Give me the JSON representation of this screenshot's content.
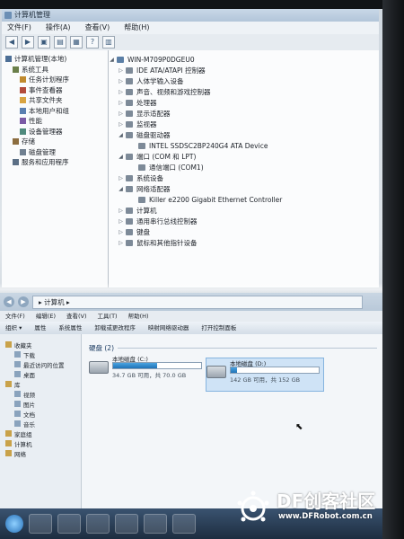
{
  "cm": {
    "title": "计算机管理",
    "menu": [
      "文件(F)",
      "操作(A)",
      "查看(V)",
      "帮助(H)"
    ],
    "tree": [
      {
        "label": "计算机管理(本地)",
        "level": 0,
        "icon": "computer-icon"
      },
      {
        "label": "系统工具",
        "level": 1,
        "icon": "tools-icon"
      },
      {
        "label": "任务计划程序",
        "level": 2,
        "icon": "clock-icon"
      },
      {
        "label": "事件查看器",
        "level": 2,
        "icon": "event-icon"
      },
      {
        "label": "共享文件夹",
        "level": 2,
        "icon": "folder-icon"
      },
      {
        "label": "本地用户和组",
        "level": 2,
        "icon": "users-icon"
      },
      {
        "label": "性能",
        "level": 2,
        "icon": "perf-icon"
      },
      {
        "label": "设备管理器",
        "level": 2,
        "icon": "device-icon"
      },
      {
        "label": "存储",
        "level": 1,
        "icon": "storage-icon"
      },
      {
        "label": "磁盘管理",
        "level": 2,
        "icon": "disk-icon"
      },
      {
        "label": "服务和应用程序",
        "level": 1,
        "icon": "services-icon"
      }
    ],
    "device_root": "WIN-M709P0DGEU0",
    "devices": [
      {
        "label": "IDE ATA/ATAPI 控制器",
        "level": 1,
        "expanded": false
      },
      {
        "label": "人体学输入设备",
        "level": 1,
        "expanded": false
      },
      {
        "label": "声音、视频和游戏控制器",
        "level": 1,
        "expanded": false
      },
      {
        "label": "处理器",
        "level": 1,
        "expanded": false
      },
      {
        "label": "显示适配器",
        "level": 1,
        "expanded": false
      },
      {
        "label": "监视器",
        "level": 1,
        "expanded": false
      },
      {
        "label": "磁盘驱动器",
        "level": 1,
        "expanded": true
      },
      {
        "label": "INTEL SSDSC2BP240G4 ATA Device",
        "level": 2,
        "expanded": null
      },
      {
        "label": "端口 (COM 和 LPT)",
        "level": 1,
        "expanded": true
      },
      {
        "label": "通信端口 (COM1)",
        "level": 2,
        "expanded": null
      },
      {
        "label": "系统设备",
        "level": 1,
        "expanded": false
      },
      {
        "label": "网络适配器",
        "level": 1,
        "expanded": true
      },
      {
        "label": "Killer e2200 Gigabit Ethernet Controller",
        "level": 2,
        "expanded": null
      },
      {
        "label": "计算机",
        "level": 1,
        "expanded": false
      },
      {
        "label": "通用串行总线控制器",
        "level": 1,
        "expanded": false
      },
      {
        "label": "键盘",
        "level": 1,
        "expanded": false
      },
      {
        "label": "鼠标和其他指针设备",
        "level": 1,
        "expanded": false
      }
    ]
  },
  "explorer": {
    "address": "▸ 计算机 ▸",
    "menu": [
      "文件(F)",
      "编辑(E)",
      "查看(V)",
      "工具(T)",
      "帮助(H)"
    ],
    "commands": [
      "组织 ▾",
      "属性",
      "系统属性",
      "卸载或更改程序",
      "映射网络驱动器",
      "打开控制面板"
    ],
    "nav": [
      {
        "label": "收藏夹",
        "sub": false
      },
      {
        "label": "下载",
        "sub": true
      },
      {
        "label": "最近访问的位置",
        "sub": true
      },
      {
        "label": "桌面",
        "sub": true
      },
      {
        "label": "库",
        "sub": false
      },
      {
        "label": "视频",
        "sub": true
      },
      {
        "label": "图片",
        "sub": true
      },
      {
        "label": "文档",
        "sub": true
      },
      {
        "label": "音乐",
        "sub": true
      },
      {
        "label": "家庭组",
        "sub": false
      },
      {
        "label": "计算机",
        "sub": false
      },
      {
        "label": "网络",
        "sub": false
      }
    ],
    "group_title": "硬盘 (2)",
    "drives": [
      {
        "name": "本地磁盘 (C:)",
        "free": "34.7 GB 可用，共 70.0 GB",
        "used_fraction": 0.5,
        "selected": false
      },
      {
        "name": "本地磁盘 (D:)",
        "free": "142 GB 可用，共 152 GB",
        "used_fraction": 0.07,
        "selected": true
      }
    ]
  },
  "watermark": {
    "main": "DF创客社区",
    "url": "www.DFRobot.com.cn"
  },
  "colors": {
    "accent": "#1f73b7",
    "watermark": "#ffffff"
  }
}
